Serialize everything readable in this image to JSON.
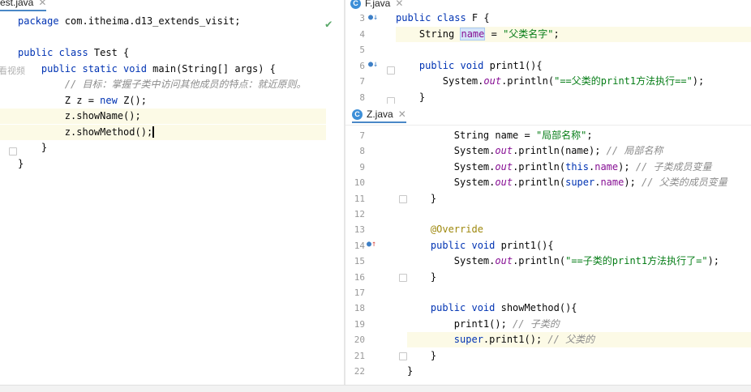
{
  "left_tab": {
    "icon": "C",
    "label": "est.java"
  },
  "left_side_label": "看视频",
  "left_code": [
    {
      "t": [
        [
          "kw",
          "package "
        ],
        [
          "",
          "com.itheima.d13_extends_visit;"
        ]
      ]
    },
    {
      "t": []
    },
    {
      "t": [
        [
          "kw",
          "public class "
        ],
        [
          "",
          "Test {"
        ]
      ]
    },
    {
      "t": [
        [
          "kw",
          "    public static void "
        ],
        [
          "",
          "main(String[] args) {"
        ]
      ]
    },
    {
      "t": [
        [
          "cmt",
          "        // 目标：掌握子类中访问其他成员的特点：就近原则。"
        ]
      ]
    },
    {
      "t": [
        [
          "",
          "        Z z = "
        ],
        [
          "kw",
          "new "
        ],
        [
          "",
          "Z();"
        ]
      ]
    },
    {
      "t": [
        [
          "",
          "        z.showName();"
        ]
      ]
    },
    {
      "t": [
        [
          "",
          "        z.showMethod();"
        ]
      ]
    },
    {
      "t": [
        [
          "",
          "    }"
        ]
      ]
    },
    {
      "t": [
        [
          "",
          "}"
        ]
      ]
    }
  ],
  "top_tab": {
    "icon": "C",
    "label": "F.java"
  },
  "top_code": [
    {
      "n": "3",
      "t": [
        [
          "kw",
          "public class "
        ],
        [
          "",
          "F {"
        ]
      ]
    },
    {
      "n": "4",
      "t": [
        [
          "",
          "    String "
        ],
        [
          "fld",
          "name"
        ],
        [
          "",
          " = "
        ],
        [
          "str",
          "\"父类名字\""
        ],
        [
          "",
          ";"
        ]
      ]
    },
    {
      "n": "5",
      "t": []
    },
    {
      "n": "6",
      "t": [
        [
          "kw",
          "    public void "
        ],
        [
          "",
          "print1(){"
        ]
      ]
    },
    {
      "n": "7",
      "t": [
        [
          "",
          "        System."
        ],
        [
          "sfld",
          "out"
        ],
        [
          "",
          ".println("
        ],
        [
          "str",
          "\"==父类的print1方法执行==\""
        ],
        [
          "",
          ");"
        ]
      ]
    },
    {
      "n": "8",
      "t": [
        [
          "",
          "    }"
        ]
      ]
    }
  ],
  "bottom_tab": {
    "icon": "C",
    "label": "Z.java"
  },
  "bottom_code": [
    {
      "n": "7",
      "t": [
        [
          "",
          "        String name = "
        ],
        [
          "str",
          "\"局部名称\""
        ],
        [
          "",
          ";"
        ]
      ]
    },
    {
      "n": "8",
      "t": [
        [
          "",
          "        System."
        ],
        [
          "sfld",
          "out"
        ],
        [
          "",
          ".println(name); "
        ],
        [
          "cmt",
          "// 局部名称"
        ]
      ]
    },
    {
      "n": "9",
      "t": [
        [
          "",
          "        System."
        ],
        [
          "sfld",
          "out"
        ],
        [
          "",
          ".println("
        ],
        [
          "kw",
          "this"
        ],
        [
          "",
          "."
        ],
        [
          "fld",
          "name"
        ],
        [
          "",
          "); "
        ],
        [
          "cmt",
          "// 子类成员变量"
        ]
      ]
    },
    {
      "n": "10",
      "t": [
        [
          "",
          "        System."
        ],
        [
          "sfld",
          "out"
        ],
        [
          "",
          ".println("
        ],
        [
          "kw",
          "super"
        ],
        [
          "",
          "."
        ],
        [
          "fld",
          "name"
        ],
        [
          "",
          "); "
        ],
        [
          "cmt",
          "// 父类的成员变量"
        ]
      ]
    },
    {
      "n": "11",
      "t": [
        [
          "",
          "    }"
        ]
      ]
    },
    {
      "n": "12",
      "t": []
    },
    {
      "n": "13",
      "t": [
        [
          "ann",
          "    @Override"
        ]
      ]
    },
    {
      "n": "14",
      "t": [
        [
          "kw",
          "    public void "
        ],
        [
          "",
          "print1(){"
        ]
      ]
    },
    {
      "n": "15",
      "t": [
        [
          "",
          "        System."
        ],
        [
          "sfld",
          "out"
        ],
        [
          "",
          ".println("
        ],
        [
          "str",
          "\"==子类的print1方法执行了=\""
        ],
        [
          "",
          ");"
        ]
      ]
    },
    {
      "n": "16",
      "t": [
        [
          "",
          "    }"
        ]
      ]
    },
    {
      "n": "17",
      "t": []
    },
    {
      "n": "18",
      "t": [
        [
          "kw",
          "    public void "
        ],
        [
          "",
          "showMethod(){"
        ]
      ]
    },
    {
      "n": "19",
      "t": [
        [
          "",
          "        print1(); "
        ],
        [
          "cmt",
          "// 子类的"
        ]
      ]
    },
    {
      "n": "20",
      "t": [
        [
          "kw",
          "        super"
        ],
        [
          "",
          ".print1(); "
        ],
        [
          "cmt",
          "// 父类的"
        ]
      ]
    },
    {
      "n": "21",
      "t": [
        [
          "",
          "    }"
        ]
      ]
    },
    {
      "n": "22",
      "t": [
        [
          "",
          "}"
        ]
      ]
    }
  ],
  "colors": {
    "keyword": "#0033b3",
    "string": "#067d17",
    "comment": "#8c8c8c",
    "field": "#871094",
    "annotation": "#9e880d",
    "checkmark": "#59a869"
  }
}
